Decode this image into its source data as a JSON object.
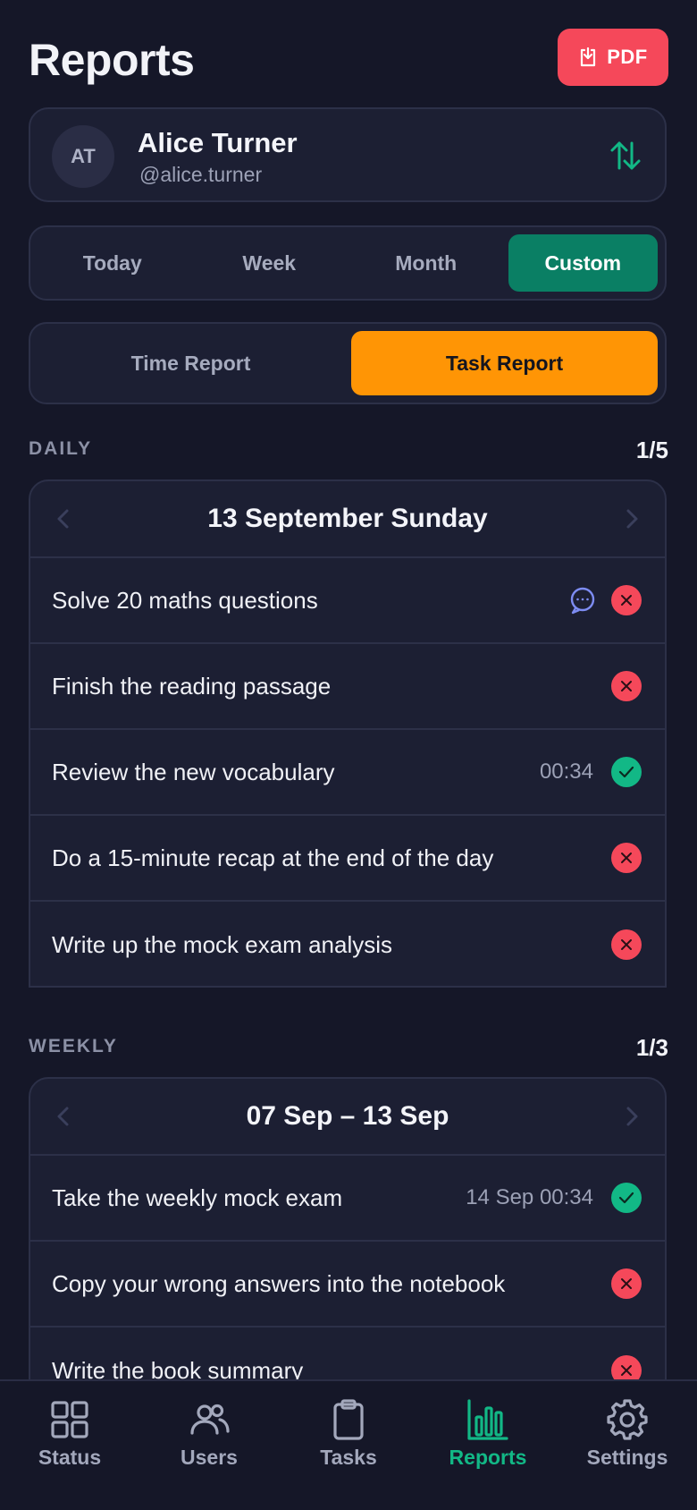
{
  "header": {
    "title": "Reports",
    "pdf_label": "PDF"
  },
  "user": {
    "initials": "AT",
    "name": "Alice Turner",
    "handle": "@alice.turner"
  },
  "period_tabs": [
    "Today",
    "Week",
    "Month",
    "Custom"
  ],
  "period_selected": "Custom",
  "report_tabs": [
    "Time Report",
    "Task Report"
  ],
  "report_selected": "Task Report",
  "daily": {
    "label": "DAILY",
    "count": "1/5",
    "date": "13 September Sunday",
    "tasks": [
      {
        "text": "Solve 20 maths questions",
        "meta": "",
        "status": "fail",
        "has_comment": true
      },
      {
        "text": "Finish the reading passage",
        "meta": "",
        "status": "fail",
        "has_comment": false
      },
      {
        "text": "Review the new vocabulary",
        "meta": "00:34",
        "status": "ok",
        "has_comment": false
      },
      {
        "text": "Do a 15-minute recap at the end of the day",
        "meta": "",
        "status": "fail",
        "has_comment": false
      },
      {
        "text": "Write up the mock exam analysis",
        "meta": "",
        "status": "fail",
        "has_comment": false
      }
    ]
  },
  "weekly": {
    "label": "WEEKLY",
    "count": "1/3",
    "date": "07 Sep – 13 Sep",
    "tasks": [
      {
        "text": "Take the weekly mock exam",
        "meta": "14 Sep 00:34",
        "status": "ok"
      },
      {
        "text": "Copy your wrong answers into the notebook",
        "meta": "",
        "status": "fail"
      },
      {
        "text": "Write the book summary",
        "meta": "",
        "status": "fail"
      }
    ]
  },
  "tabbar": [
    {
      "label": "Status",
      "icon": "grid-icon"
    },
    {
      "label": "Users",
      "icon": "users-icon"
    },
    {
      "label": "Tasks",
      "icon": "clipboard-icon"
    },
    {
      "label": "Reports",
      "icon": "bar-chart-icon"
    },
    {
      "label": "Settings",
      "icon": "gear-icon"
    }
  ],
  "colors": {
    "accent_green": "#12b886",
    "accent_orange": "#ff9505",
    "danger": "#f5485a",
    "background": "#151728"
  }
}
